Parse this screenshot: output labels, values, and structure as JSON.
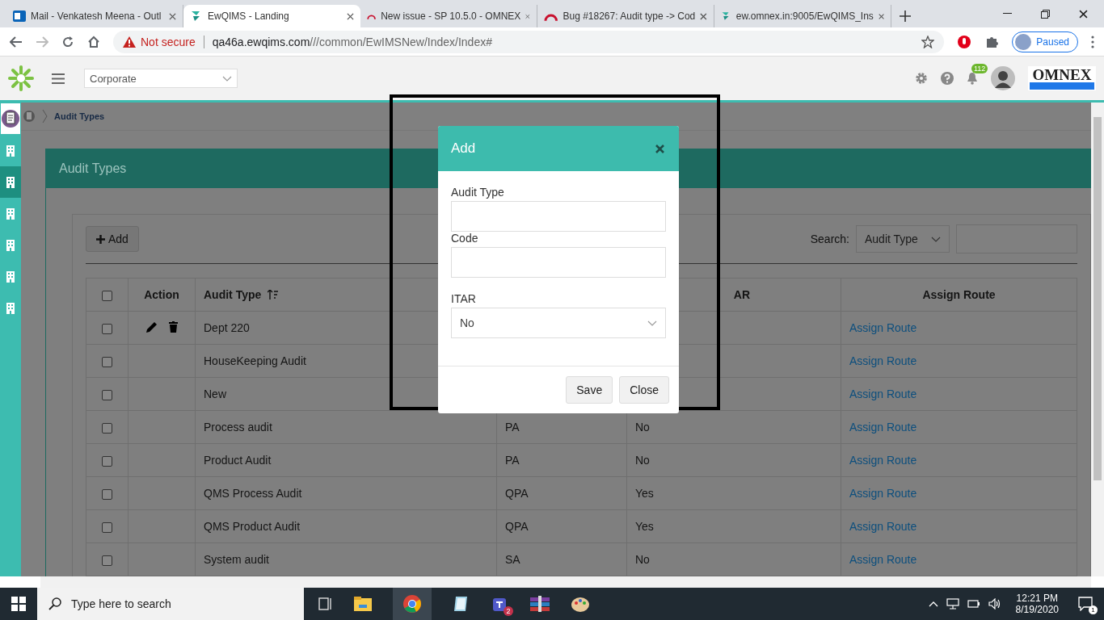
{
  "browser": {
    "tabs": [
      {
        "title": "Mail - Venkatesh Meena - Outl",
        "kind": "mail",
        "selected": false
      },
      {
        "title": "EwQIMS - Landing",
        "kind": "app",
        "selected": true
      },
      {
        "title": "New issue - SP 10.5.0 - OMNEX",
        "kind": "bug",
        "selected": false
      },
      {
        "title": "Bug #18267: Audit type -> Cod",
        "kind": "bug",
        "selected": false
      },
      {
        "title": "ew.omnex.in:9005/EwQIMS_Ins",
        "kind": "app",
        "selected": false
      }
    ],
    "security": "Not secure",
    "host": "qa46a.ewqims.com",
    "path": "///common/EwIMSNew/Index/Index#",
    "profile": "Paused"
  },
  "header": {
    "org": "Corporate",
    "notifications": "112",
    "logo": "OMNEX"
  },
  "sidebar": {
    "items": [
      {
        "kind": "document",
        "selected": false
      },
      {
        "kind": "building",
        "selected": false
      },
      {
        "kind": "building",
        "selected": true
      },
      {
        "kind": "building",
        "selected": false
      },
      {
        "kind": "building",
        "selected": false
      },
      {
        "kind": "building",
        "selected": false
      },
      {
        "kind": "building",
        "selected": false
      }
    ]
  },
  "breadcrumb": "Audit Types",
  "panel": {
    "title": "Audit Types",
    "add_button": "Add",
    "search_label": "Search:",
    "search_by": "Audit Type"
  },
  "table": {
    "select_all_checked": false,
    "columns": [
      "Action",
      "Audit Type",
      "AR",
      "Assign Route"
    ],
    "rows": [
      {
        "checked": false,
        "actions": true,
        "audit_type": "Dept 220",
        "link": "Assign Route"
      },
      {
        "checked": false,
        "actions": false,
        "audit_type": "HouseKeeping Audit",
        "link": "Assign Route"
      },
      {
        "checked": false,
        "actions": false,
        "audit_type": "New",
        "link": "Assign Route"
      },
      {
        "checked": false,
        "actions": false,
        "audit_type": "Process audit",
        "code": "PA",
        "itar": "No",
        "link": "Assign Route"
      },
      {
        "checked": false,
        "actions": false,
        "audit_type": "Product Audit",
        "code": "PA",
        "itar": "No",
        "link": "Assign Route"
      },
      {
        "checked": false,
        "actions": false,
        "audit_type": "QMS Process Audit",
        "code": "QPA",
        "itar": "Yes",
        "link": "Assign Route"
      },
      {
        "checked": false,
        "actions": false,
        "audit_type": "QMS Product Audit",
        "code": "QPA",
        "itar": "Yes",
        "link": "Assign Route"
      },
      {
        "checked": false,
        "actions": false,
        "audit_type": "System audit",
        "code": "SA",
        "itar": "No",
        "link": "Assign Route"
      }
    ]
  },
  "modal": {
    "title": "Add",
    "fields": [
      {
        "kind": "text",
        "label": "Audit Type"
      },
      {
        "kind": "text",
        "label": "Code"
      },
      {
        "kind": "select",
        "label": "ITAR",
        "value": "No"
      }
    ],
    "buttons": [
      "Save",
      "Close"
    ]
  },
  "taskbar": {
    "search_placeholder": "Type here to search",
    "teams_badge": "2",
    "time": "12:21 PM",
    "date": "8/19/2020",
    "notifications": "1"
  }
}
